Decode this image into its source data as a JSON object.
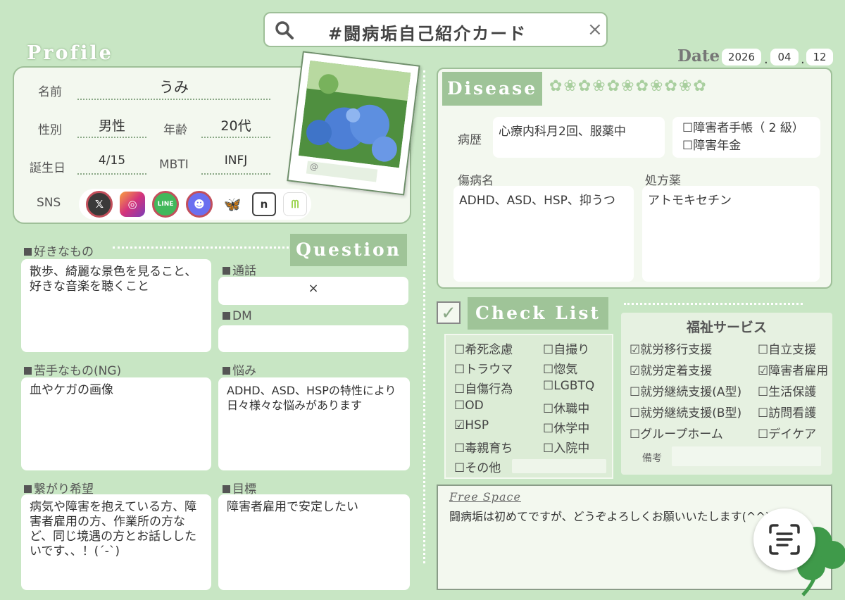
{
  "search": {
    "text": "#闘病垢自己紹介カード",
    "close": "×"
  },
  "profile": {
    "heading": "Profile",
    "name_label": "名前",
    "name": "うみ",
    "gender_label": "性別",
    "gender": "男性",
    "age_label": "年齢",
    "age": "20代",
    "birthday_label": "誕生日",
    "birthday": "4/15",
    "mbti_label": "MBTI",
    "mbti": "INFJ",
    "sns_label": "SNS",
    "photo_handle": "@"
  },
  "date": {
    "label": "Date",
    "year": "2026",
    "month": "04",
    "day": "12",
    "sep": "."
  },
  "question": {
    "heading": "Question",
    "likes_label": "好きなもの",
    "likes": "散歩、綺麗な景色を見ること、好きな音楽を聴くこと",
    "call_label": "通話",
    "call": "×",
    "dm_label": "DM",
    "dm": "",
    "ng_label": "苦手なもの(NG)",
    "ng": "血やケガの画像",
    "worry_label": "悩み",
    "worry": "ADHD、ASD、HSPの特性により日々様々な悩みがあります",
    "connect_label": "繋がり希望",
    "connect": "病気や障害を抱えている方、障害者雇用の方、作業所の方など、同じ境遇の方とお話ししたいです、、！(´-`)",
    "goal_label": "目標",
    "goal": "障害者雇用で安定したい"
  },
  "disease": {
    "heading": "Disease",
    "history_label": "病歴",
    "history": "心療内科月2回、服薬中",
    "notebook": "☐障害者手帳（ 2 級）",
    "pension": "☐障害年金",
    "diagnosis_label": "傷病名",
    "diagnosis": "ADHD、ASD、HSP、抑うつ",
    "medication_label": "処方薬",
    "medication": "アトモキセチン"
  },
  "checklist": {
    "heading": "Check List",
    "left": [
      "☐希死念慮",
      "☐トラウマ",
      "☐自傷行為",
      "☐OD",
      "☑HSP",
      "☐毒親育ち",
      "☐その他"
    ],
    "right": [
      "☐自撮り",
      "☐惚気",
      "☐LGBTQ",
      "☐休職中",
      "☐休学中",
      "☐入院中"
    ]
  },
  "welfare": {
    "heading": "福祉サービス",
    "left": [
      "☑就労移行支援",
      "☑就労定着支援",
      "☐就労継続支援(A型)",
      "☐就労継続支援(B型)",
      "☐グループホーム"
    ],
    "right": [
      "☐自立支援",
      "☑障害者雇用",
      "☐生活保護",
      "☐訪問看護",
      "☐デイケア"
    ],
    "notes_label": "備考"
  },
  "free": {
    "heading": "Free Space",
    "text": "闘病垢は初めてですが、どうぞよろしくお願いいたします(^^)"
  },
  "colors": {
    "bg": "#c8e6c4",
    "band": "#9fc498",
    "card": "#f3f8ef"
  }
}
